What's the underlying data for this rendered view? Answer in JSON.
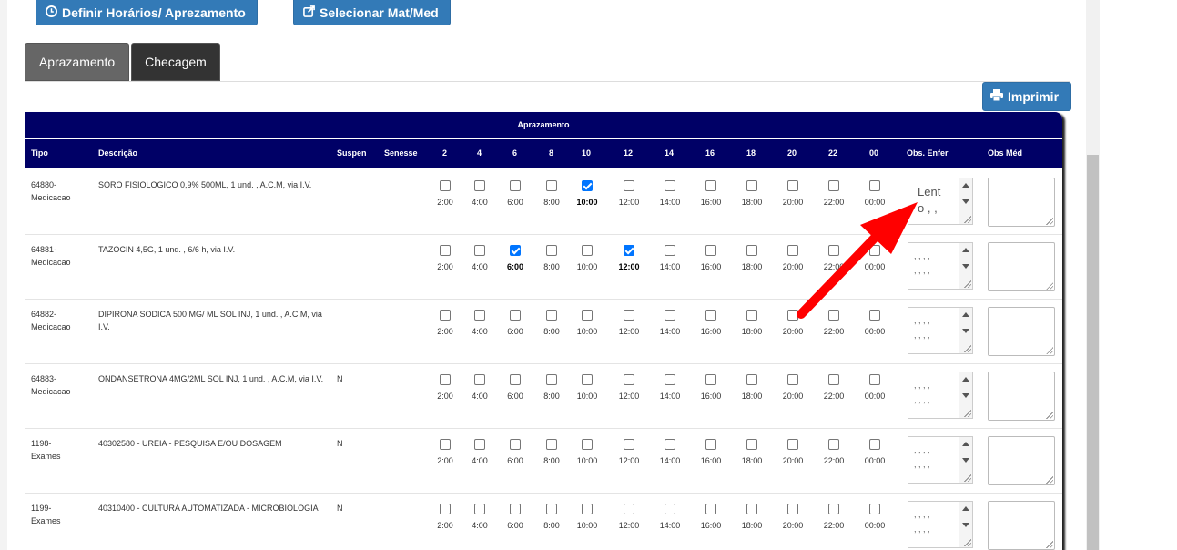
{
  "toolbar": {
    "define_label": "Definir Horários/ Aprezamento",
    "select_label": "Selecionar Mat/Med",
    "print_label": "Imprimir"
  },
  "tabs": [
    {
      "label": "Aprazamento",
      "active": true
    },
    {
      "label": "Checagem",
      "active": false
    }
  ],
  "table": {
    "title": "Aprazamento",
    "headers": {
      "tipo": "Tipo",
      "descricao": "Descrição",
      "suspen": "Suspen",
      "senesse": "Senesse",
      "hours": [
        "2",
        "4",
        "6",
        "8",
        "10",
        "12",
        "14",
        "16",
        "18",
        "20",
        "22",
        "00"
      ],
      "obs_enf": "Obs. Enfer",
      "obs_med": "Obs Méd"
    },
    "slot_labels": [
      "2:00",
      "4:00",
      "6:00",
      "8:00",
      "10:00",
      "12:00",
      "14:00",
      "16:00",
      "18:00",
      "20:00",
      "22:00",
      "00:00"
    ],
    "rows": [
      {
        "tipo_id": "64880-",
        "tipo_name": "Medicacao",
        "desc": "SORO FISIOLOGICO 0,9% 500ML, 1 und. , A.C.M, via I.V.",
        "suspen": "",
        "checked": [
          "10:00"
        ],
        "obs_enf": "Lent\no , ,",
        "obs_med": ""
      },
      {
        "tipo_id": "64881-",
        "tipo_name": "Medicacao",
        "desc": "TAZOCIN 4,5G, 1 und. , 6/6 h, via I.V.",
        "suspen": "",
        "checked": [
          "6:00",
          "12:00"
        ],
        "obs_enf": ", , , ,\n, , , ,",
        "obs_med": ""
      },
      {
        "tipo_id": "64882-",
        "tipo_name": "Medicacao",
        "desc": "DIPIRONA SODICA 500 MG/ ML SOL INJ, 1 und. , A.C.M, via I.V.",
        "suspen": "",
        "checked": [],
        "obs_enf": ", , , ,\n, , , ,",
        "obs_med": ""
      },
      {
        "tipo_id": "64883-",
        "tipo_name": "Medicacao",
        "desc": "ONDANSETRONA 4MG/2ML SOL INJ, 1 und. , A.C.M, via I.V.",
        "suspen": "N",
        "checked": [],
        "obs_enf": ", , , ,\n, , , ,",
        "obs_med": ""
      },
      {
        "tipo_id": "1198-",
        "tipo_name": "Exames",
        "desc": "40302580 - UREIA - PESQUISA E/OU DOSAGEM",
        "suspen": "N",
        "checked": [],
        "obs_enf": ", , , ,\n, , , ,",
        "obs_med": ""
      },
      {
        "tipo_id": "1199-",
        "tipo_name": "Exames",
        "desc": "40310400 - CULTURA AUTOMATIZADA - MICROBIOLOGIA",
        "suspen": "N",
        "checked": [],
        "obs_enf": ", , , ,\n, , , ,",
        "obs_med": ""
      }
    ]
  },
  "icons": {
    "define": "clock-icon",
    "select": "external-link-icon",
    "print": "printer-icon"
  },
  "colors": {
    "button": "#337ab7",
    "header": "#000066",
    "tab_active": "#666666",
    "tab_inactive": "#333333",
    "arrow": "#ff0000",
    "checkbox_on": "#0075ff"
  }
}
